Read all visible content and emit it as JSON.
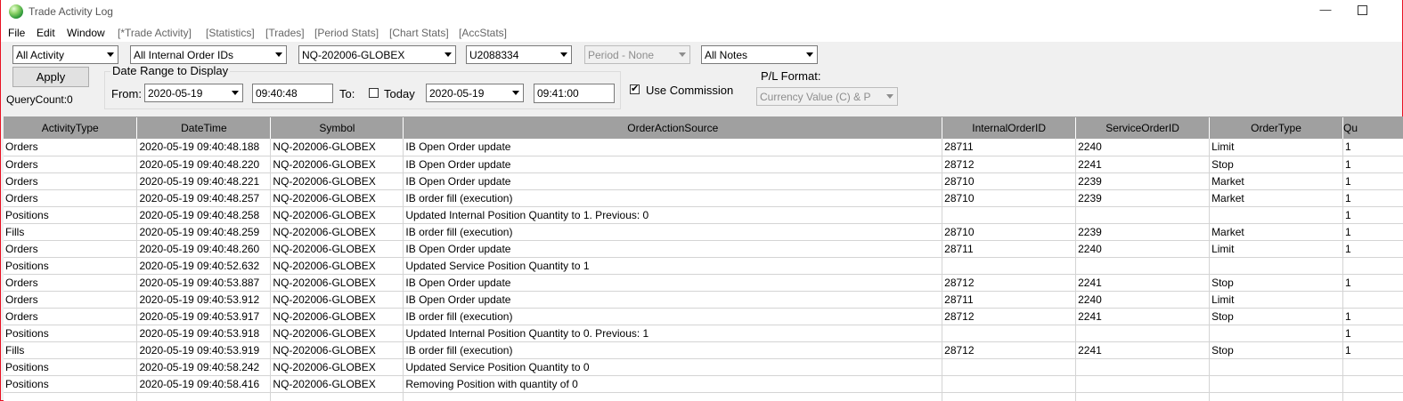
{
  "window": {
    "title": "Trade Activity Log",
    "minimize": "—"
  },
  "menu": [
    {
      "label": "File",
      "tab": false
    },
    {
      "label": "Edit",
      "tab": false
    },
    {
      "label": "Window",
      "tab": false
    },
    {
      "label": "[*Trade Activity]",
      "tab": true
    },
    {
      "label": "[Statistics]",
      "tab": true
    },
    {
      "label": "[Trades]",
      "tab": true
    },
    {
      "label": "[Period Stats]",
      "tab": true
    },
    {
      "label": "[Chart Stats]",
      "tab": true
    },
    {
      "label": "[AccStats]",
      "tab": true
    }
  ],
  "filters": {
    "activity": "All Activity",
    "order_ids": "All Internal Order IDs",
    "symbol": "NQ-202006-GLOBEX",
    "account": "U2088334",
    "period": "Period - None",
    "notes": "All Notes"
  },
  "apply_label": "Apply",
  "query_count": "QueryCount:0",
  "date_range": {
    "title": "Date Range to Display",
    "from_label": "From:",
    "from_date": "2020-05-19",
    "from_time": "09:40:48",
    "to_label": "To:",
    "today_label": "Today",
    "to_date": "2020-05-19",
    "to_time": "09:41:00"
  },
  "use_commission": {
    "label": "Use Commission",
    "checked": true
  },
  "pl_format": {
    "label": "P/L Format:",
    "value": "Currency Value (C) & P"
  },
  "table": {
    "columns": [
      "ActivityType",
      "DateTime",
      "Symbol",
      "OrderActionSource",
      "InternalOrderID",
      "ServiceOrderID",
      "OrderType",
      "Qu"
    ],
    "rows": [
      [
        "Orders",
        "2020-05-19  09:40:48.188",
        "NQ-202006-GLOBEX",
        "IB Open Order update",
        "28711",
        "2240",
        "Limit",
        "1"
      ],
      [
        "Orders",
        "2020-05-19  09:40:48.220",
        "NQ-202006-GLOBEX",
        "IB Open Order update",
        "28712",
        "2241",
        "Stop",
        "1"
      ],
      [
        "Orders",
        "2020-05-19  09:40:48.221",
        "NQ-202006-GLOBEX",
        "IB Open Order update",
        "28710",
        "2239",
        "Market",
        "1"
      ],
      [
        "Orders",
        "2020-05-19  09:40:48.257",
        "NQ-202006-GLOBEX",
        "IB order fill (execution)",
        "28710",
        "2239",
        "Market",
        "1"
      ],
      [
        "Positions",
        "2020-05-19  09:40:48.258",
        "NQ-202006-GLOBEX",
        "Updated Internal Position Quantity to 1. Previous: 0",
        "",
        "",
        "",
        "1"
      ],
      [
        "Fills",
        "2020-05-19  09:40:48.259",
        "NQ-202006-GLOBEX",
        "IB order fill (execution)",
        "28710",
        "2239",
        "Market",
        "1"
      ],
      [
        "Orders",
        "2020-05-19  09:40:48.260",
        "NQ-202006-GLOBEX",
        "IB Open Order update",
        "28711",
        "2240",
        "Limit",
        "1"
      ],
      [
        "Positions",
        "2020-05-19  09:40:52.632",
        "NQ-202006-GLOBEX",
        "Updated Service Position Quantity to 1",
        "",
        "",
        "",
        ""
      ],
      [
        "Orders",
        "2020-05-19  09:40:53.887",
        "NQ-202006-GLOBEX",
        "IB Open Order update",
        "28712",
        "2241",
        "Stop",
        "1"
      ],
      [
        "Orders",
        "2020-05-19  09:40:53.912",
        "NQ-202006-GLOBEX",
        "IB Open Order update",
        "28711",
        "2240",
        "Limit",
        ""
      ],
      [
        "Orders",
        "2020-05-19  09:40:53.917",
        "NQ-202006-GLOBEX",
        "IB order fill (execution)",
        "28712",
        "2241",
        "Stop",
        "1"
      ],
      [
        "Positions",
        "2020-05-19  09:40:53.918",
        "NQ-202006-GLOBEX",
        "Updated Internal Position Quantity to 0. Previous: 1",
        "",
        "",
        "",
        "1"
      ],
      [
        "Fills",
        "2020-05-19  09:40:53.919",
        "NQ-202006-GLOBEX",
        "IB order fill (execution)",
        "28712",
        "2241",
        "Stop",
        "1"
      ],
      [
        "Positions",
        "2020-05-19  09:40:58.242",
        "NQ-202006-GLOBEX",
        "Updated Service Position Quantity to 0",
        "",
        "",
        "",
        ""
      ],
      [
        "Positions",
        "2020-05-19  09:40:58.416",
        "NQ-202006-GLOBEX",
        "Removing Position with quantity of 0",
        "",
        "",
        "",
        ""
      ],
      [
        "",
        "",
        "",
        "",
        "",
        "",
        "",
        ""
      ]
    ]
  }
}
